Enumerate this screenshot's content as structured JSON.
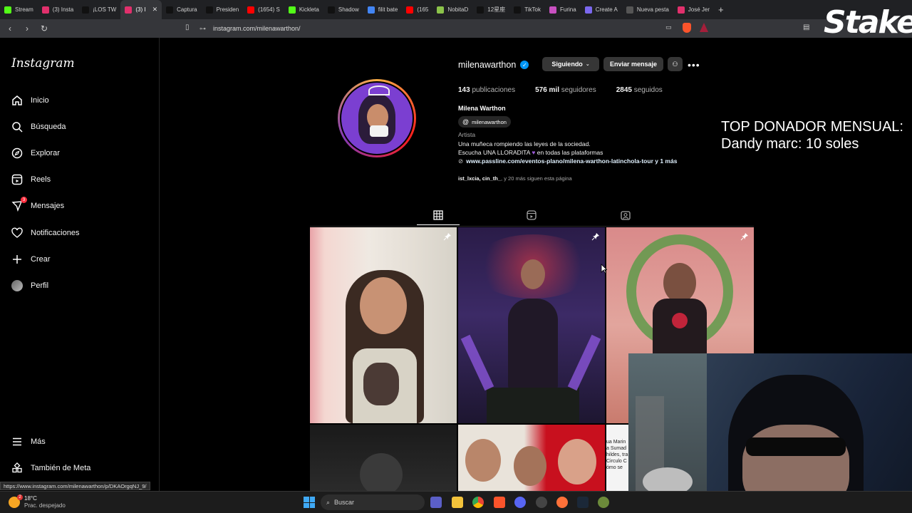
{
  "browser": {
    "tabs": [
      {
        "label": "Stream",
        "color": "#53fc18"
      },
      {
        "label": "(3) Insta",
        "color": "#e1306c"
      },
      {
        "label": "¡LOS TW",
        "color": "#111111"
      },
      {
        "label": "(3) I",
        "color": "#e1306c",
        "active": true
      },
      {
        "label": "Captura",
        "color": "#111111"
      },
      {
        "label": "Presiden",
        "color": "#111111"
      },
      {
        "label": "(1654) S",
        "color": "#ff0000"
      },
      {
        "label": "Kickleta",
        "color": "#53fc18"
      },
      {
        "label": "Shadow",
        "color": "#111111"
      },
      {
        "label": "filit bate",
        "color": "#4285f4"
      },
      {
        "label": "(165",
        "color": "#ff0000"
      },
      {
        "label": "NobitaD",
        "color": "#8bc34a"
      },
      {
        "label": "12星座",
        "color": "#111111"
      },
      {
        "label": "TikTok",
        "color": "#111111"
      },
      {
        "label": "Furina",
        "color": "#c850c0"
      },
      {
        "label": "Create A",
        "color": "#7b68ee"
      },
      {
        "label": "Nueva pesta",
        "color": "#555555"
      },
      {
        "label": "José Jer",
        "color": "#e1306c"
      }
    ],
    "url": "instagram.com/milenawarthon/"
  },
  "stake_logo": "Stake",
  "sidebar": {
    "logo": "Instagram",
    "items": [
      {
        "label": "Inicio",
        "icon": "home-icon"
      },
      {
        "label": "Búsqueda",
        "icon": "search-icon"
      },
      {
        "label": "Explorar",
        "icon": "compass-icon"
      },
      {
        "label": "Reels",
        "icon": "reels-icon"
      },
      {
        "label": "Mensajes",
        "icon": "messenger-icon",
        "badge": "3"
      },
      {
        "label": "Notificaciones",
        "icon": "heart-icon"
      },
      {
        "label": "Crear",
        "icon": "plus-icon"
      },
      {
        "label": "Perfil",
        "icon": "avatar"
      }
    ],
    "bottom": [
      {
        "label": "Más",
        "icon": "menu-icon"
      },
      {
        "label": "También de Meta",
        "icon": "meta-grid-icon"
      }
    ]
  },
  "profile": {
    "username": "milenawarthon",
    "following_button": "Siguiendo",
    "message_button": "Enviar mensaje",
    "posts_count": "143",
    "posts_label": "publicaciones",
    "followers_count": "576 mil",
    "followers_label": "seguidores",
    "following_count": "2845",
    "following_label": "seguidos",
    "full_name": "Milena Warthon",
    "threads_handle": "milenawarthon",
    "category": "Artista",
    "bio_line1": "Una muñeca rompiendo las leyes de la sociedad.",
    "bio_line2_a": "Escucha UNA LLORADITA",
    "bio_line2_b": "en todas las plataformas",
    "link": "www.passline.com/eventos-plano/milena-warthon-latinchola-tour y 1 más",
    "followed_by_users": "ist_lxcia, cin_th_",
    "followed_by_rest": ", y 20 más siguen esta página"
  },
  "overlay": {
    "donor_line1": "TOP DONADOR MENSUAL:",
    "donor_line2": "Dandy marc: 10 soles"
  },
  "grid_captions": {
    "post6_text": "ua Marina Sumad hildes, tra Circulo Cómo se"
  },
  "status_bar_url": "https://www.instagram.com/milenawarthon/p/DKAOrgqNJ_9/",
  "taskbar": {
    "temperature": "18°C",
    "weather": "Prac. despejado",
    "weather_badge": "2",
    "search_placeholder": "Buscar"
  }
}
